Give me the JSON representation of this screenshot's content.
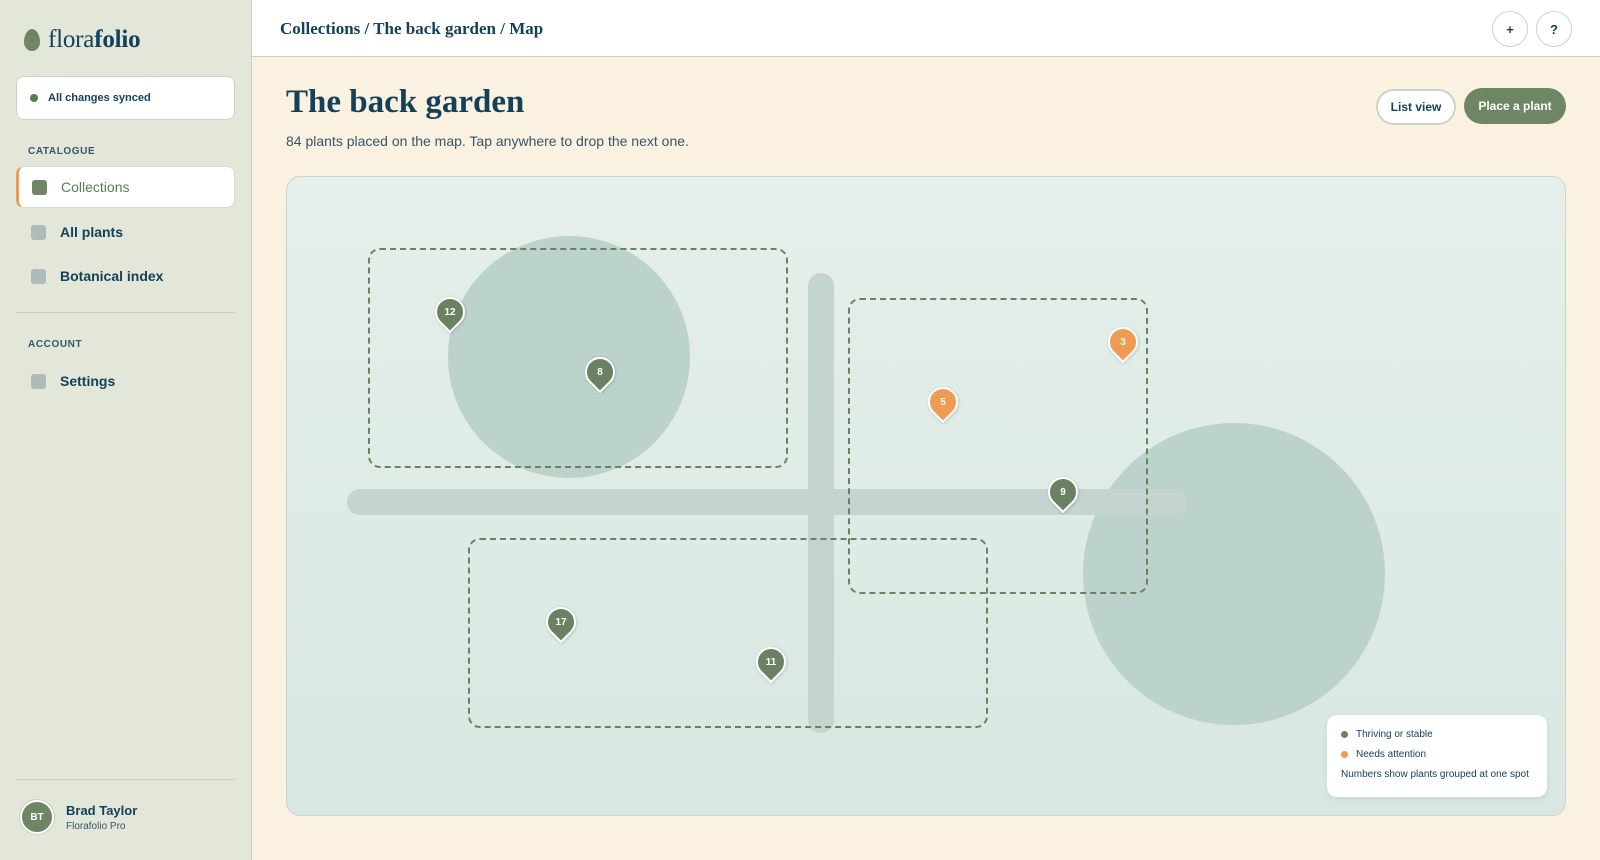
{
  "app": {
    "logo_light": "flora",
    "logo_bold": "folio"
  },
  "sync": {
    "status": "All changes synced"
  },
  "sidebar": {
    "catalogue_label": "CATALOGUE",
    "catalogue_items": [
      {
        "label": "Collections",
        "active": true
      },
      {
        "label": "All plants",
        "active": false
      },
      {
        "label": "Botanical index",
        "active": false
      }
    ],
    "account_label": "ACCOUNT",
    "account_items": [
      {
        "label": "Settings",
        "active": false
      }
    ]
  },
  "user": {
    "initials": "BT",
    "name": "Brad Taylor",
    "plan": "Florafolio Pro"
  },
  "topbar": {
    "breadcrumb": "Collections / The back garden / Map",
    "add_label": "+",
    "help_label": "?"
  },
  "header": {
    "title": "The back garden",
    "subtitle": "84 plants placed on the map. Tap anywhere to drop the next one.",
    "list_view_label": "List view",
    "place_plant_label": "Place a plant"
  },
  "map": {
    "pins": [
      {
        "count": "12",
        "status": "thriving"
      },
      {
        "count": "8",
        "status": "thriving"
      },
      {
        "count": "3",
        "status": "attention"
      },
      {
        "count": "5",
        "status": "attention"
      },
      {
        "count": "9",
        "status": "thriving"
      },
      {
        "count": "17",
        "status": "thriving"
      },
      {
        "count": "11",
        "status": "thriving"
      }
    ],
    "legend": {
      "thriving_label": "Thriving or stable",
      "attention_label": "Needs attention",
      "note": "Numbers show plants grouped at one spot"
    }
  },
  "colors": {
    "thriving": "#6b8262",
    "attention": "#ef9c52",
    "accent": "#ef9c52",
    "primary": "#6e8664",
    "ink": "#15405a"
  }
}
